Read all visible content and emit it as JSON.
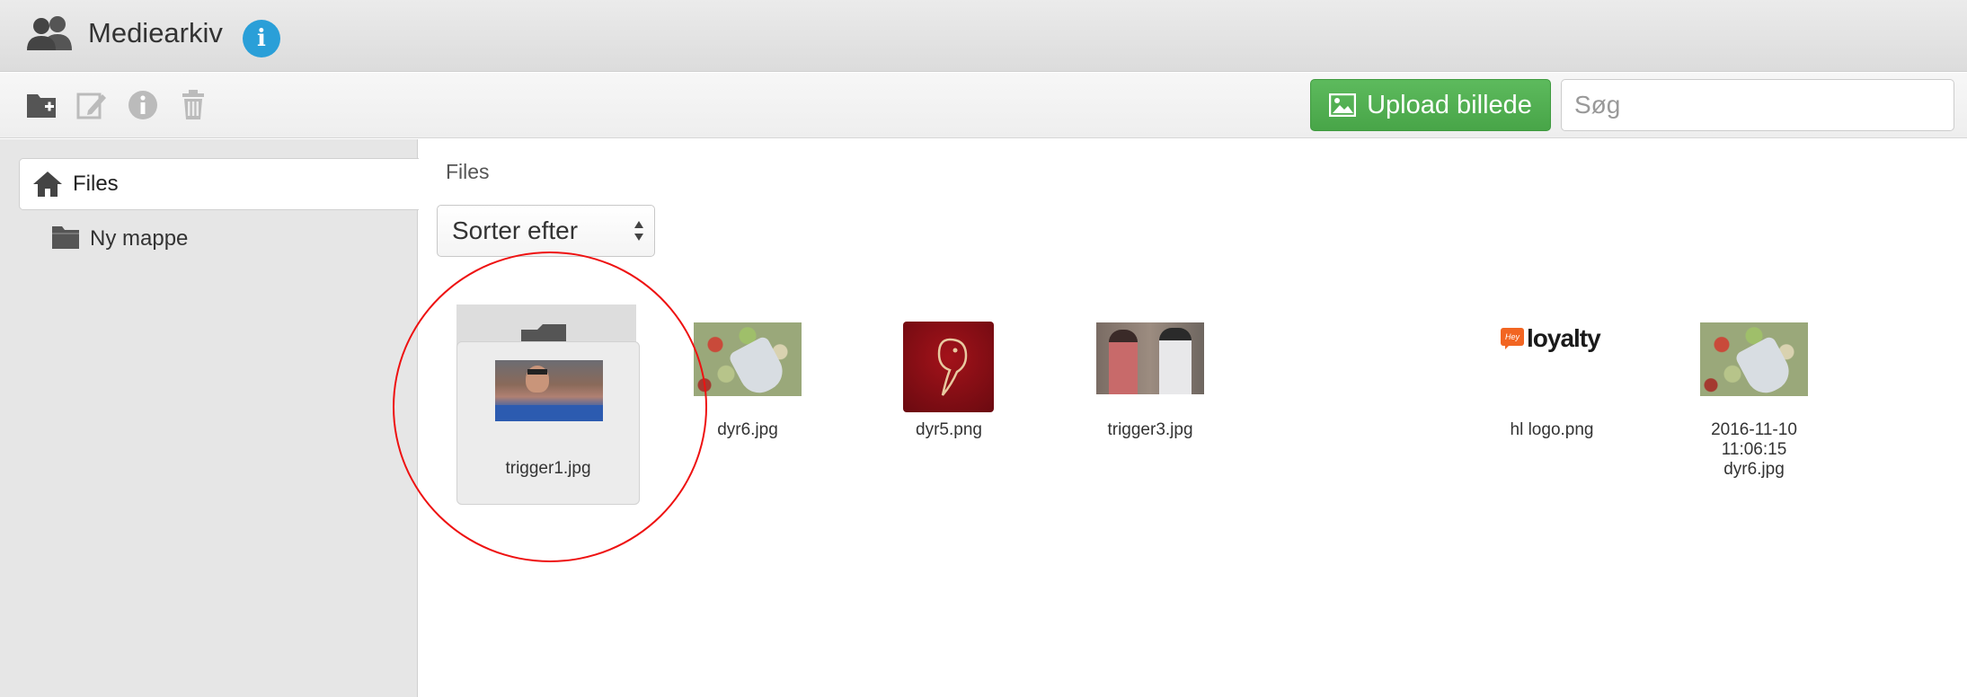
{
  "header": {
    "title": "Mediearkiv",
    "info_icon_glyph": "i",
    "icons": [
      "users-icon",
      "info-icon"
    ],
    "accent_color": "#2a9fd8"
  },
  "toolbar": {
    "icons": [
      "new-folder-icon",
      "edit-icon",
      "info-icon",
      "trash-icon"
    ],
    "upload_label": "Upload billede",
    "upload_color": "#4cae4c",
    "search_placeholder": "Søg"
  },
  "sidebar": {
    "items": [
      {
        "label": "Files",
        "icon": "home-icon",
        "selected": true
      },
      {
        "label": "Ny mappe",
        "icon": "folder-icon",
        "selected": false
      }
    ]
  },
  "main": {
    "breadcrumb": "Files",
    "sort": {
      "selected": "Sorter efter"
    },
    "files": [
      {
        "name": "trigger1.jpg",
        "selected": true
      },
      {
        "name": "dyr6.jpg"
      },
      {
        "name": "dyr5.png"
      },
      {
        "name": "trigger3.jpg"
      },
      {
        "name": "hl logo.png",
        "logo_text": "loyalty",
        "logo_badge_text": "Hey"
      },
      {
        "name": "2016-11-10 11:06:15 dyr6.jpg"
      }
    ]
  },
  "annotation": {
    "highlight_color": "#e11111"
  }
}
